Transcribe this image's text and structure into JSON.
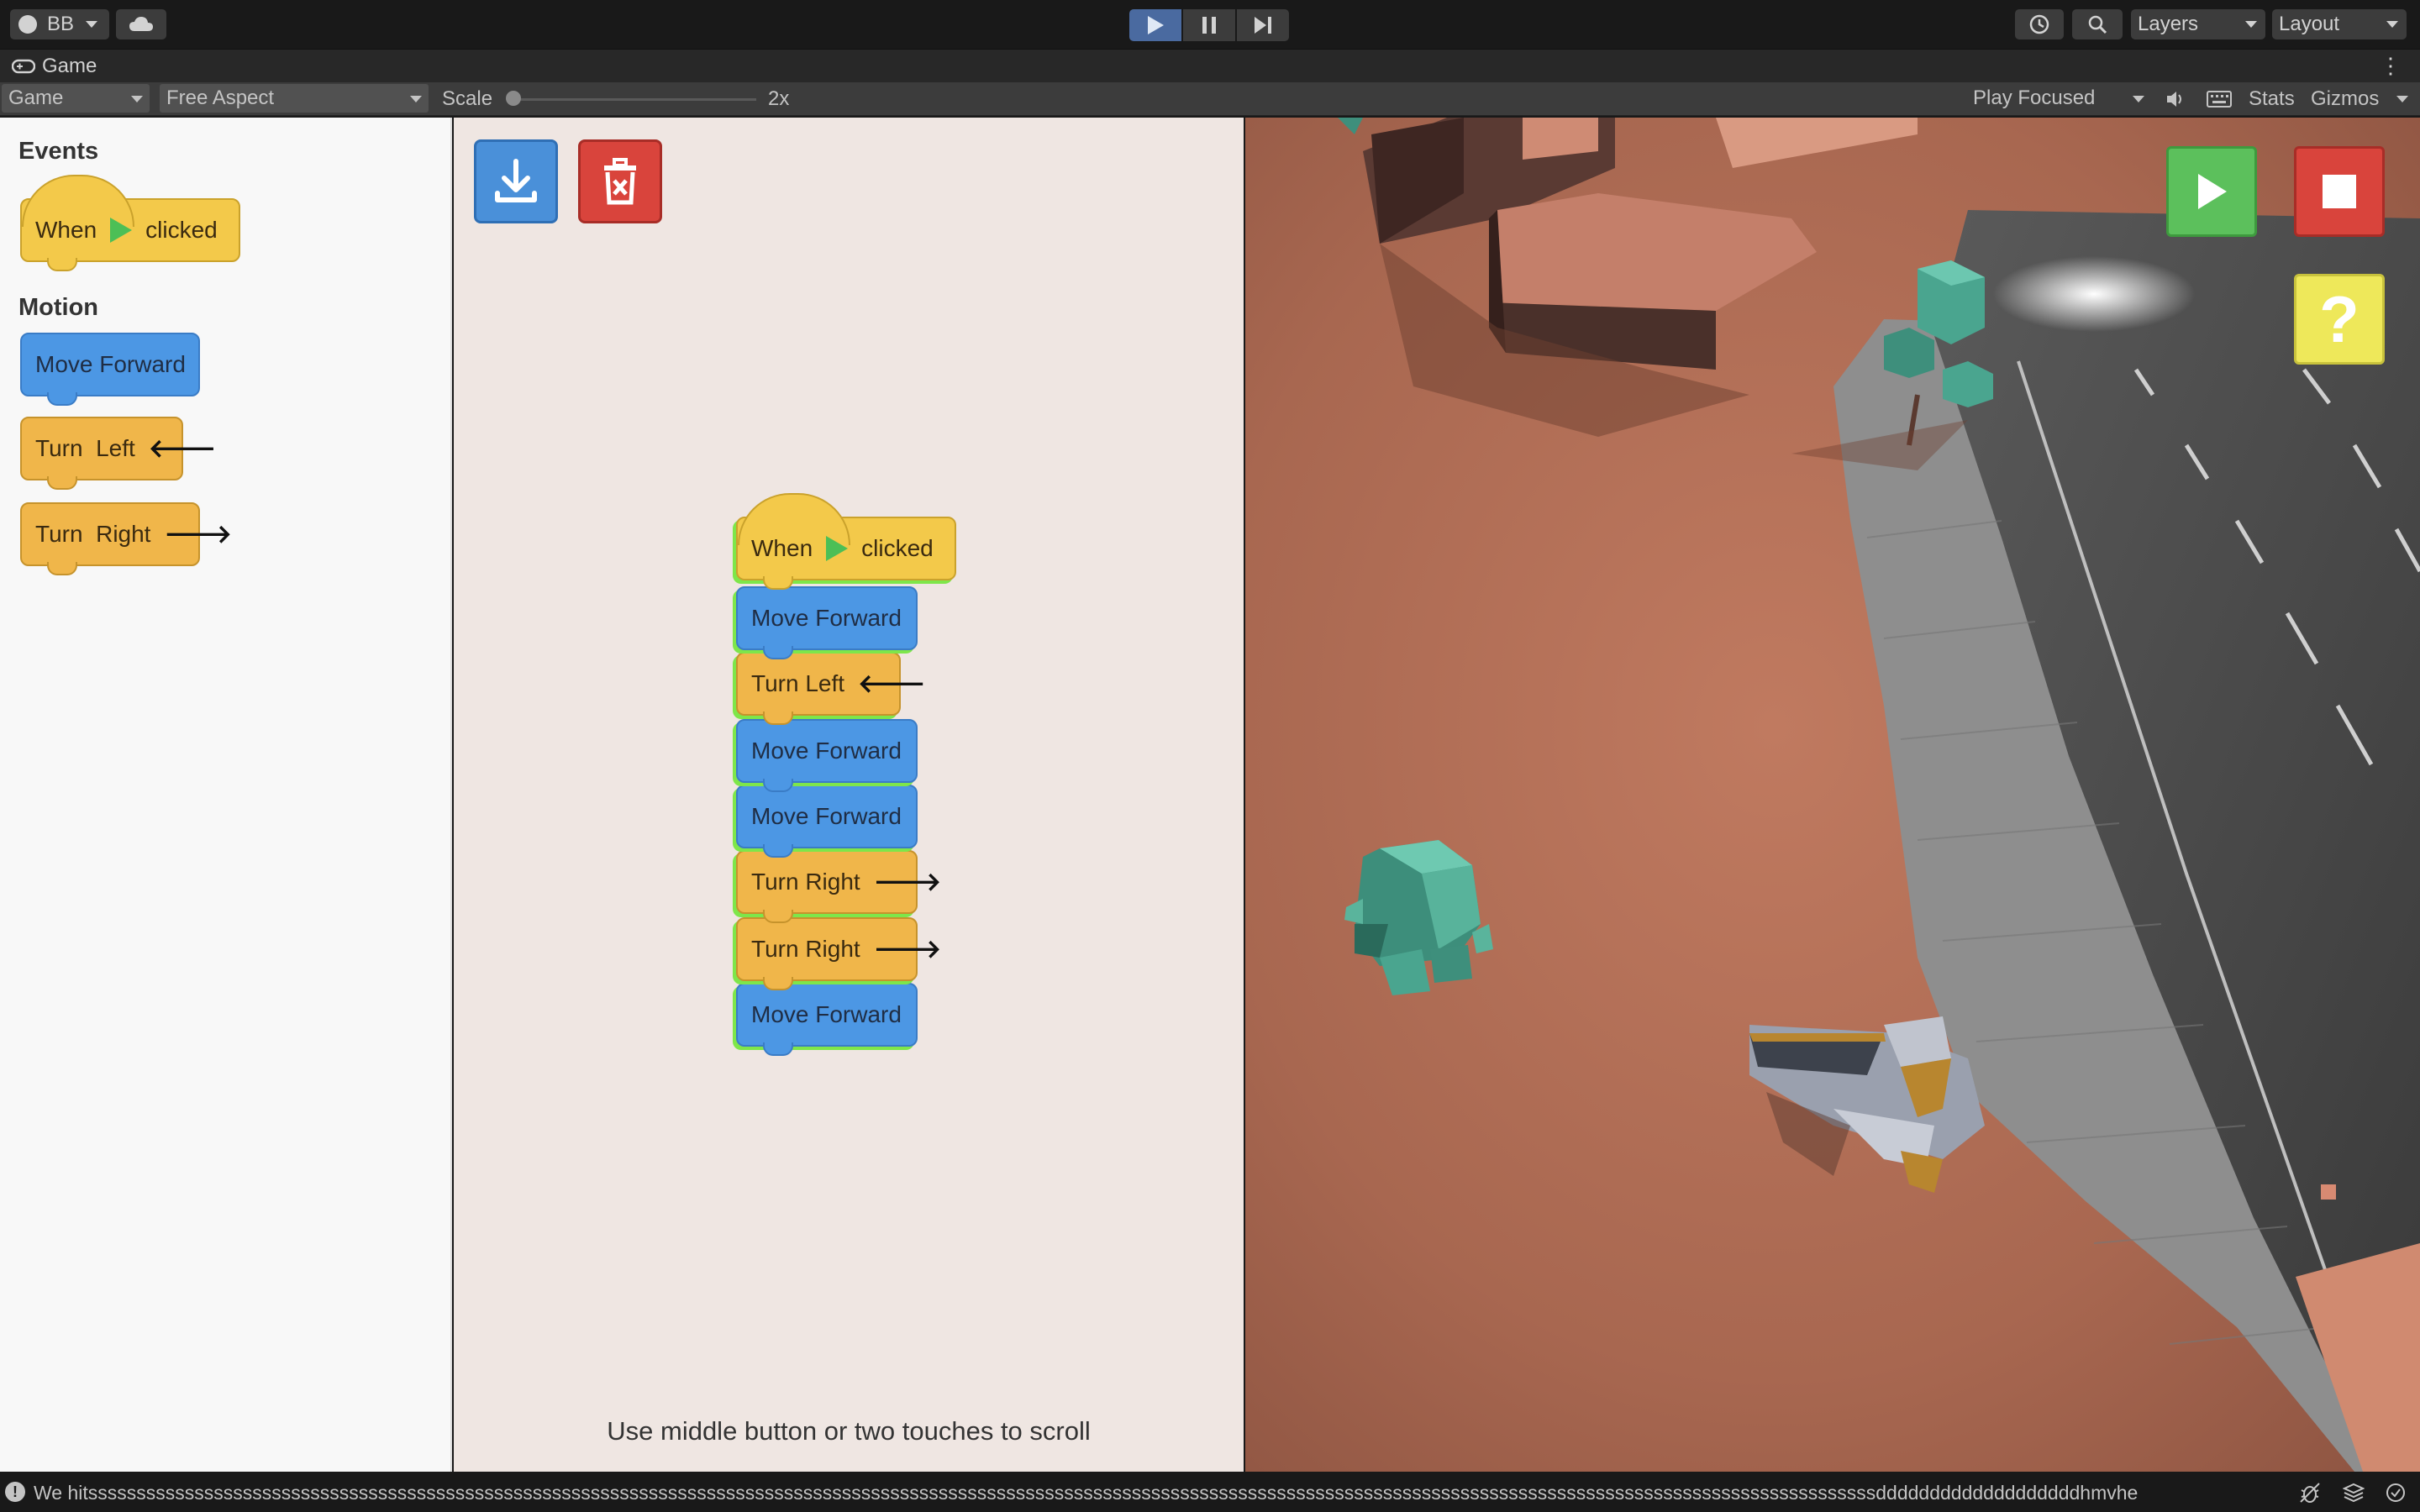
{
  "toolbar": {
    "account_label": "BB",
    "layers_label": "Layers",
    "layout_label": "Layout"
  },
  "tabbar": {
    "tab_label": "Game"
  },
  "game_controls": {
    "display_label": "Game",
    "aspect_label": "Free Aspect",
    "scale_label": "Scale",
    "scale_value": "2x",
    "play_mode_label": "Play Focused",
    "stats_label": "Stats",
    "gizmos_label": "Gizmos"
  },
  "palette": {
    "events_title": "Events",
    "motion_title": "Motion",
    "event_block": {
      "when": "When",
      "clicked": "clicked"
    },
    "motion_blocks": [
      {
        "label": "Move Forward",
        "color": "blue"
      },
      {
        "label": "Turn  Left",
        "color": "orange",
        "arrow": "🡐"
      },
      {
        "label": "Turn  Right",
        "color": "orange",
        "arrow": "🡒"
      }
    ]
  },
  "workspace": {
    "script": [
      {
        "label": "When",
        "suffix": "clicked",
        "type": "hat"
      },
      {
        "label": "Move Forward",
        "type": "blue"
      },
      {
        "label": "Turn Left",
        "type": "orange",
        "arrow": "🡐"
      },
      {
        "label": "Move Forward",
        "type": "blue"
      },
      {
        "label": "Move Forward",
        "type": "blue"
      },
      {
        "label": "Turn Right",
        "type": "orange",
        "arrow": "🡒"
      },
      {
        "label": "Turn Right",
        "type": "orange",
        "arrow": "🡒"
      },
      {
        "label": "Move Forward",
        "type": "blue"
      }
    ],
    "scroll_hint": "Use middle button or two touches to scroll"
  },
  "scene": {
    "help_label": "?"
  },
  "status": {
    "message": "We hitsssssssssssssssssssssssssssssssssssssssssssssssssssssssssssssssssssssssssssssssssssssssssssssssssssssssssssssssssssssssssssssssssssssssssssssssssssssssssssssssssssssssssssssssssssssssssdddddddddddddddddddhmvhe"
  },
  "colors": {
    "block_blue": "#4c97e4",
    "block_orange": "#f0b64a",
    "block_yellow": "#f3c94a",
    "flag_green": "#4cbf56",
    "run_green": "#5cc05c",
    "stop_red": "#d9443c",
    "help_yellow": "#eee85a"
  }
}
